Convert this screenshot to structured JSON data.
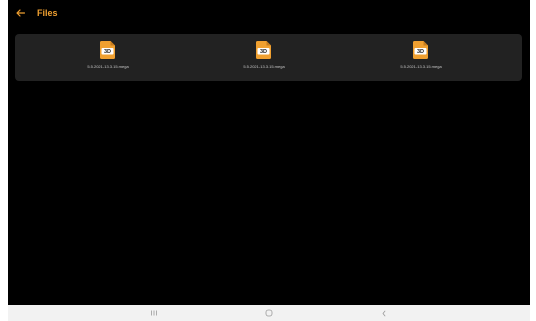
{
  "app_bar": {
    "title": "Files",
    "back_icon": "arrow-left-icon"
  },
  "files": [
    {
      "name": "5.5.2021-13.3.15.mega",
      "icon": "3d-file-icon",
      "icon_label": "3D"
    },
    {
      "name": "5.5.2021-13.3.15.mega",
      "icon": "3d-file-icon",
      "icon_label": "3D"
    },
    {
      "name": "5.5.2021-13.3.15.mega",
      "icon": "3d-file-icon",
      "icon_label": "3D"
    }
  ],
  "nav_bar": {
    "recents_icon": "recents-icon",
    "home_icon": "home-icon",
    "back_icon": "back-chevron-icon"
  },
  "colors": {
    "accent": "#f0a030",
    "background": "#000000",
    "panel": "#222222",
    "nav_bar": "#f2f2f2"
  }
}
